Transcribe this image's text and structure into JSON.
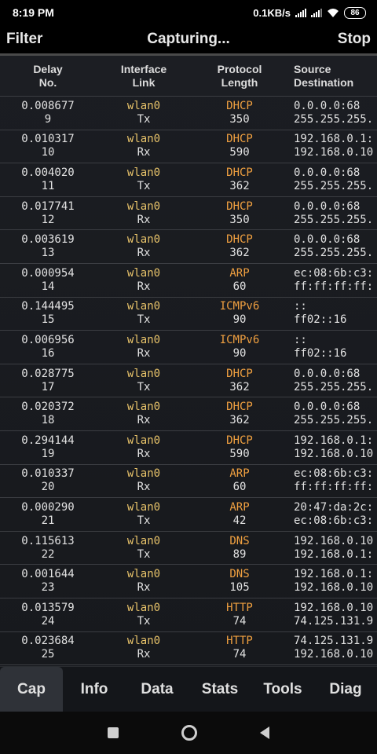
{
  "status_bar": {
    "time": "8:19 PM",
    "network_speed": "0.1KB/s",
    "battery": "86",
    "icons": [
      "signal-icon",
      "signal-icon",
      "wifi-icon",
      "battery-icon"
    ]
  },
  "toolbar": {
    "filter_label": "Filter",
    "title": "Capturing...",
    "stop_label": "Stop"
  },
  "table": {
    "headers": [
      {
        "line1": "Delay",
        "line2": "No."
      },
      {
        "line1": "Interface",
        "line2": "Link"
      },
      {
        "line1": "Protocol",
        "line2": "Length"
      },
      {
        "line1": "Source",
        "line2": "Destination"
      }
    ],
    "rows": [
      {
        "delay": "0.008677",
        "no": "9",
        "iface": "wlan0",
        "link": "Tx",
        "proto": "DHCP",
        "len": "350",
        "src": "0.0.0.0:68",
        "dst": "255.255.255."
      },
      {
        "delay": "0.010317",
        "no": "10",
        "iface": "wlan0",
        "link": "Rx",
        "proto": "DHCP",
        "len": "590",
        "src": "192.168.0.1:",
        "dst": "192.168.0.10"
      },
      {
        "delay": "0.004020",
        "no": "11",
        "iface": "wlan0",
        "link": "Tx",
        "proto": "DHCP",
        "len": "362",
        "src": "0.0.0.0:68",
        "dst": "255.255.255."
      },
      {
        "delay": "0.017741",
        "no": "12",
        "iface": "wlan0",
        "link": "Rx",
        "proto": "DHCP",
        "len": "350",
        "src": "0.0.0.0:68",
        "dst": "255.255.255."
      },
      {
        "delay": "0.003619",
        "no": "13",
        "iface": "wlan0",
        "link": "Rx",
        "proto": "DHCP",
        "len": "362",
        "src": "0.0.0.0:68",
        "dst": "255.255.255."
      },
      {
        "delay": "0.000954",
        "no": "14",
        "iface": "wlan0",
        "link": "Rx",
        "proto": "ARP",
        "len": "60",
        "src": "ec:08:6b:c3:",
        "dst": "ff:ff:ff:ff:"
      },
      {
        "delay": "0.144495",
        "no": "15",
        "iface": "wlan0",
        "link": "Tx",
        "proto": "ICMPv6",
        "len": "90",
        "src": "::",
        "dst": "ff02::16"
      },
      {
        "delay": "0.006956",
        "no": "16",
        "iface": "wlan0",
        "link": "Rx",
        "proto": "ICMPv6",
        "len": "90",
        "src": "::",
        "dst": "ff02::16"
      },
      {
        "delay": "0.028775",
        "no": "17",
        "iface": "wlan0",
        "link": "Tx",
        "proto": "DHCP",
        "len": "362",
        "src": "0.0.0.0:68",
        "dst": "255.255.255."
      },
      {
        "delay": "0.020372",
        "no": "18",
        "iface": "wlan0",
        "link": "Rx",
        "proto": "DHCP",
        "len": "362",
        "src": "0.0.0.0:68",
        "dst": "255.255.255."
      },
      {
        "delay": "0.294144",
        "no": "19",
        "iface": "wlan0",
        "link": "Rx",
        "proto": "DHCP",
        "len": "590",
        "src": "192.168.0.1:",
        "dst": "192.168.0.10"
      },
      {
        "delay": "0.010337",
        "no": "20",
        "iface": "wlan0",
        "link": "Rx",
        "proto": "ARP",
        "len": "60",
        "src": "ec:08:6b:c3:",
        "dst": "ff:ff:ff:ff:"
      },
      {
        "delay": "0.000290",
        "no": "21",
        "iface": "wlan0",
        "link": "Tx",
        "proto": "ARP",
        "len": "42",
        "src": "20:47:da:2c:",
        "dst": "ec:08:6b:c3:"
      },
      {
        "delay": "0.115613",
        "no": "22",
        "iface": "wlan0",
        "link": "Tx",
        "proto": "DNS",
        "len": "89",
        "src": "192.168.0.10",
        "dst": "192.168.0.1:"
      },
      {
        "delay": "0.001644",
        "no": "23",
        "iface": "wlan0",
        "link": "Rx",
        "proto": "DNS",
        "len": "105",
        "src": "192.168.0.1:",
        "dst": "192.168.0.10"
      },
      {
        "delay": "0.013579",
        "no": "24",
        "iface": "wlan0",
        "link": "Tx",
        "proto": "HTTP",
        "len": "74",
        "src": "192.168.0.10",
        "dst": "74.125.131.9"
      },
      {
        "delay": "0.023684",
        "no": "25",
        "iface": "wlan0",
        "link": "Rx",
        "proto": "HTTP",
        "len": "74",
        "src": "74.125.131.9",
        "dst": "192.168.0.10"
      }
    ]
  },
  "tabs": [
    {
      "label": "Cap",
      "active": true
    },
    {
      "label": "Info",
      "active": false
    },
    {
      "label": "Data",
      "active": false
    },
    {
      "label": "Stats",
      "active": false
    },
    {
      "label": "Tools",
      "active": false
    },
    {
      "label": "Diag",
      "active": false
    }
  ],
  "nav_bar": {
    "icons": [
      "recents-icon",
      "home-icon",
      "back-icon"
    ]
  },
  "colors": {
    "interface": "#e8c36a",
    "protocol": "#f0a040",
    "text": "#e2e2e2",
    "background": "#1b1d22"
  }
}
